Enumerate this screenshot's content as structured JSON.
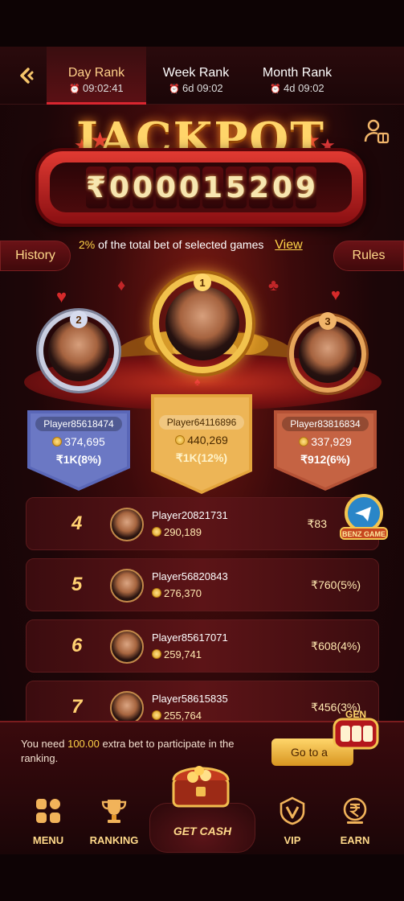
{
  "header": {
    "tabs": [
      {
        "label": "Day Rank",
        "time": "09:02:41",
        "active": true
      },
      {
        "label": "Week Rank",
        "time": "6d 09:02",
        "active": false
      },
      {
        "label": "Month Rank",
        "time": "4d 09:02",
        "active": false
      }
    ]
  },
  "jackpot": {
    "title": "JACKPOT",
    "currency": "₹",
    "digits": [
      "0",
      "0",
      "0",
      "0",
      "1",
      "5",
      "2",
      "0",
      "9"
    ],
    "note_pct": "2%",
    "note_text": "of the total bet of selected games",
    "view_label": "View"
  },
  "side_buttons": {
    "history": "History",
    "rules": "Rules"
  },
  "podium": {
    "first": {
      "rank": "1",
      "player": "Player64116896",
      "coins": "440,269",
      "prize": "₹1K(12%)"
    },
    "second": {
      "rank": "2",
      "player": "Player85618474",
      "coins": "374,695",
      "prize": "₹1K(8%)"
    },
    "third": {
      "rank": "3",
      "player": "Player83816834",
      "coins": "337,929",
      "prize": "₹912(6%)"
    }
  },
  "rows": [
    {
      "rank": "4",
      "player": "Player20821731",
      "coins": "290,189",
      "prize": "₹83"
    },
    {
      "rank": "5",
      "player": "Player56820843",
      "coins": "276,370",
      "prize": "₹760(5%)"
    },
    {
      "rank": "6",
      "player": "Player85617071",
      "coins": "259,741",
      "prize": "₹608(4%)"
    },
    {
      "rank": "7",
      "player": "Player58615835",
      "coins": "255,764",
      "prize": "₹456(3%)"
    }
  ],
  "notice": {
    "text_before": "You need ",
    "amount": "100.00",
    "text_after": " extra bet to participate in the ranking.",
    "button_label": "Go to a"
  },
  "badges": {
    "benz": "BENZ GAME",
    "gen": "GEN"
  },
  "nav": {
    "menu": "MENU",
    "ranking": "RANKING",
    "get_cash": "GET CASH",
    "vip": "VIP",
    "earn": "EARN"
  },
  "colors": {
    "accent": "#ffd348",
    "brand_red": "#d92630",
    "gold": "#ffd071"
  }
}
